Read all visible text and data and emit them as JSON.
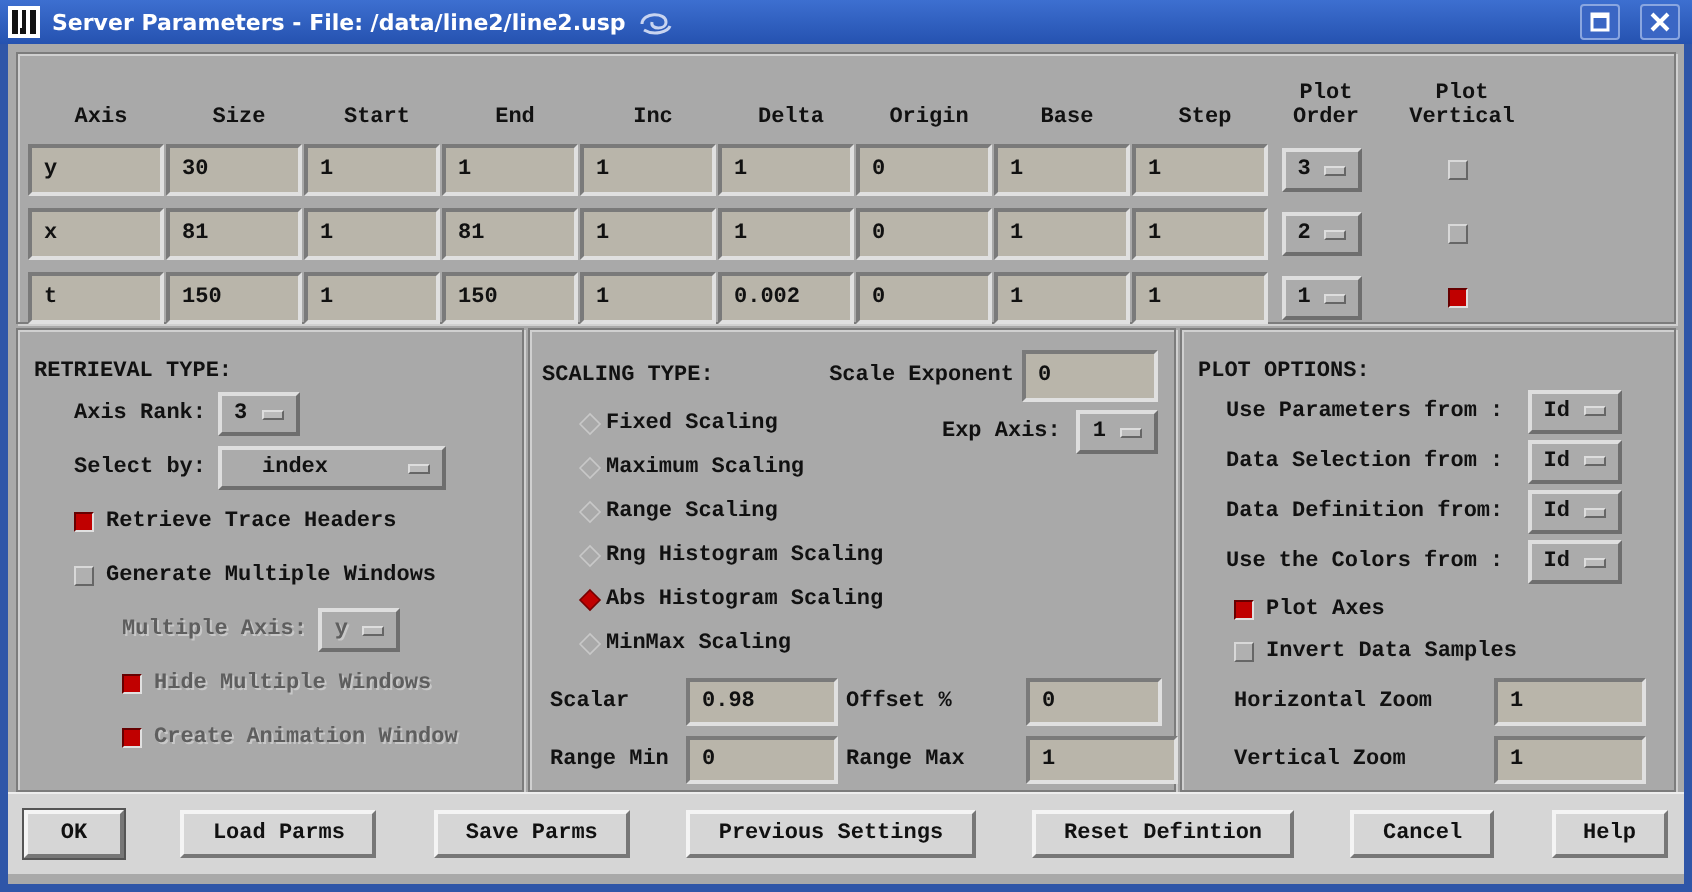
{
  "window": {
    "title": "Server Parameters - File: /data/line2/line2.usp"
  },
  "axes_table": {
    "columns": [
      "Axis",
      "Size",
      "Start",
      "End",
      "Inc",
      "Delta",
      "Origin",
      "Base",
      "Step",
      "Plot Order",
      "Plot Vertical"
    ],
    "rows": [
      {
        "cells": [
          "y",
          "30",
          "1",
          "1",
          "1",
          "1",
          "0",
          "1",
          "1"
        ],
        "plot_order": "3",
        "plot_vertical": false
      },
      {
        "cells": [
          "x",
          "81",
          "1",
          "81",
          "1",
          "1",
          "0",
          "1",
          "1"
        ],
        "plot_order": "2",
        "plot_vertical": false
      },
      {
        "cells": [
          "t",
          "150",
          "1",
          "150",
          "1",
          "0.002",
          "0",
          "1",
          "1"
        ],
        "plot_order": "1",
        "plot_vertical": true
      }
    ]
  },
  "retrieval": {
    "title": "RETRIEVAL TYPE:",
    "items": [
      {
        "kind": "dropdown",
        "label": "Axis Rank:",
        "value": "3",
        "disabled": false
      },
      {
        "kind": "wide-dropdown",
        "label": "Select by:",
        "value": "index",
        "disabled": false
      },
      {
        "kind": "checkbox",
        "label": "Retrieve Trace Headers",
        "checked": true,
        "disabled": false
      },
      {
        "kind": "checkbox",
        "label": "Generate Multiple Windows",
        "checked": false,
        "disabled": false,
        "children": [
          {
            "kind": "dropdown",
            "label": "Multiple Axis:",
            "value": "y",
            "disabled": true
          },
          {
            "kind": "checkbox",
            "label": "Hide Multiple Windows",
            "checked": true,
            "disabled": true
          },
          {
            "kind": "checkbox",
            "label": "Create Animation Window",
            "checked": true,
            "disabled": true
          }
        ]
      }
    ]
  },
  "scaling": {
    "title": "SCALING TYPE:",
    "scale_exponent": {
      "label": "Scale Exponent",
      "value": "0"
    },
    "exp_axis": {
      "label": "Exp Axis:",
      "value": "1"
    },
    "modes": [
      {
        "label": "Fixed Scaling",
        "selected": false
      },
      {
        "label": "Maximum Scaling",
        "selected": false
      },
      {
        "label": "Range Scaling",
        "selected": false
      },
      {
        "label": "Rng Histogram Scaling",
        "selected": false
      },
      {
        "label": "Abs Histogram Scaling",
        "selected": true
      },
      {
        "label": "MinMax Scaling",
        "selected": false
      }
    ],
    "fields": [
      {
        "label": "Scalar",
        "value": "0.98"
      },
      {
        "label": "Offset %",
        "value": "0"
      },
      {
        "label": "Range Min",
        "value": "0"
      },
      {
        "label": "Range Max",
        "value": "1"
      }
    ]
  },
  "plot_options": {
    "title": "PLOT OPTIONS:",
    "sources": [
      {
        "label": "Use Parameters from :",
        "value": "Id"
      },
      {
        "label": "Data Selection from :",
        "value": "Id"
      },
      {
        "label": "Data Definition from:",
        "value": "Id"
      },
      {
        "label": "Use the Colors from :",
        "value": "Id"
      }
    ],
    "checks": [
      {
        "label": "Plot Axes",
        "checked": true
      },
      {
        "label": "Invert Data Samples",
        "checked": false
      }
    ],
    "zooms": [
      {
        "label": "Horizontal Zoom",
        "value": "1"
      },
      {
        "label": "Vertical Zoom",
        "value": "1"
      }
    ]
  },
  "buttons": [
    "OK",
    "Load Parms",
    "Save Parms",
    "Previous Settings",
    "Reset Defintion",
    "Cancel",
    "Help"
  ]
}
